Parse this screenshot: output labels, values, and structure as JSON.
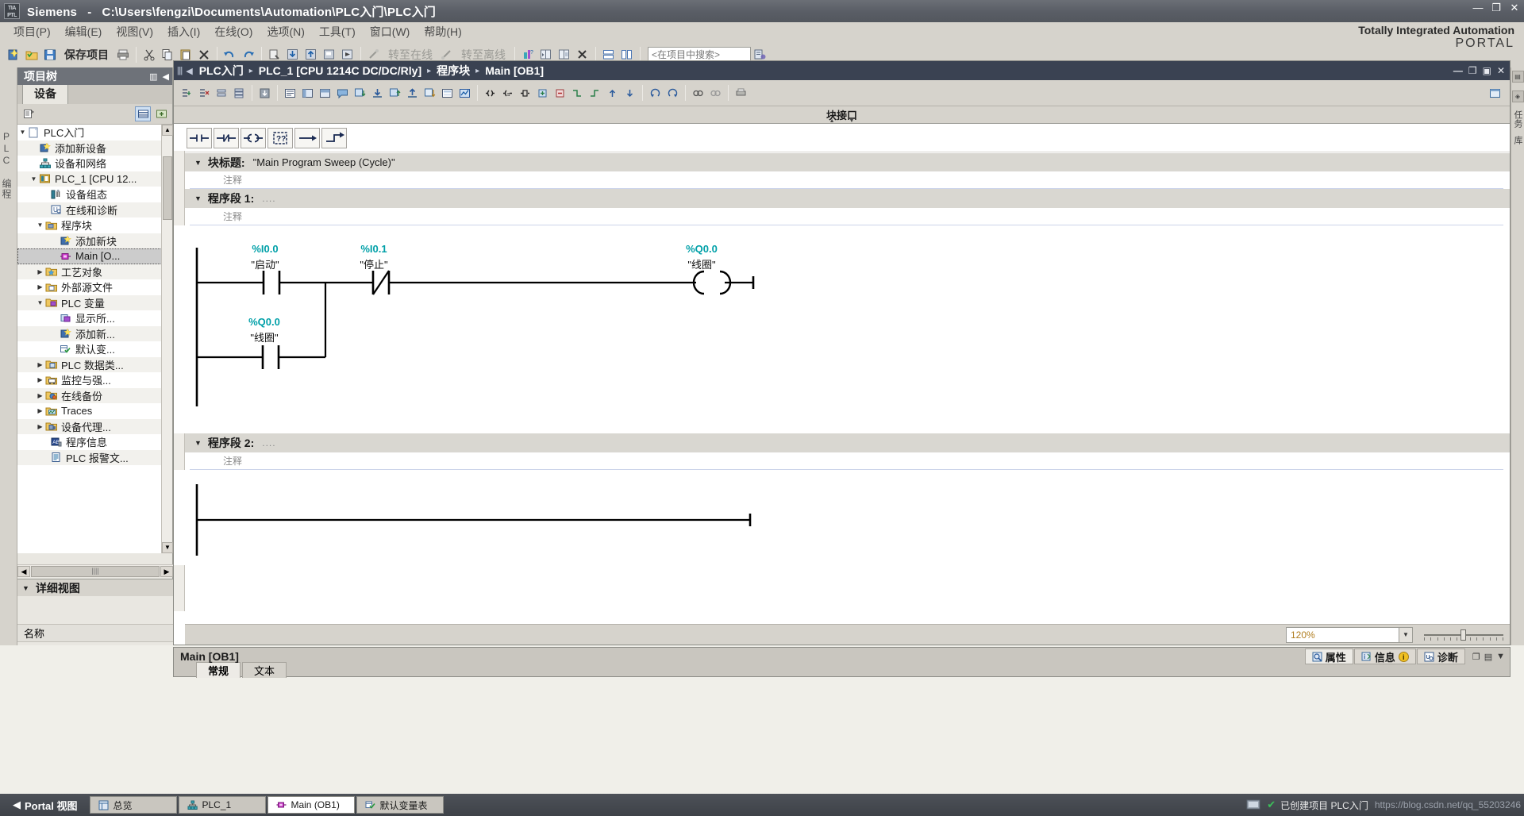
{
  "window": {
    "app_name": "Siemens",
    "separator": "-",
    "path": "C:\\Users\\fengzi\\Documents\\Automation\\PLC入门\\PLC入门",
    "logo_text": "TIA",
    "minimize": "—",
    "maximize": "❐",
    "close": "✕"
  },
  "menubar": [
    {
      "label": "项目(P)"
    },
    {
      "label": "编辑(E)"
    },
    {
      "label": "视图(V)"
    },
    {
      "label": "插入(I)"
    },
    {
      "label": "在线(O)"
    },
    {
      "label": "选项(N)"
    },
    {
      "label": "工具(T)"
    },
    {
      "label": "窗口(W)"
    },
    {
      "label": "帮助(H)"
    }
  ],
  "toolbar": {
    "save_label": "保存项目",
    "goto_online_label": "转至在线",
    "goto_offline_label": "转至离线",
    "search_placeholder": "<在项目中搜索>"
  },
  "brand": {
    "line1": "Totally Integrated Automation",
    "line2": "PORTAL"
  },
  "left_strip": {
    "vertical_label": "PLC 编程"
  },
  "project_tree": {
    "header": "项目树",
    "tab": "设备",
    "nodes": [
      {
        "label": "PLC入门",
        "indent": 0,
        "arrow": "▼",
        "icon": "project-icon"
      },
      {
        "label": "添加新设备",
        "indent": 1,
        "arrow": "",
        "icon": "add-device-icon"
      },
      {
        "label": "设备和网络",
        "indent": 1,
        "arrow": "",
        "icon": "network-icon"
      },
      {
        "label": "PLC_1 [CPU 12...",
        "indent": 1,
        "arrow": "▼",
        "icon": "plc-icon"
      },
      {
        "label": "设备组态",
        "indent": 2,
        "arrow": "",
        "icon": "device-config-icon"
      },
      {
        "label": "在线和诊断",
        "indent": 2,
        "arrow": "",
        "icon": "online-diag-icon"
      },
      {
        "label": "程序块",
        "indent": 2,
        "arrow": "▼",
        "icon": "program-blocks-icon"
      },
      {
        "label": "添加新块",
        "indent": 3,
        "arrow": "",
        "icon": "add-block-icon"
      },
      {
        "label": "Main [O...",
        "indent": 3,
        "arrow": "",
        "icon": "ob-block-icon",
        "selected": true
      },
      {
        "label": "工艺对象",
        "indent": 2,
        "arrow": "▶",
        "icon": "tech-object-icon"
      },
      {
        "label": "外部源文件",
        "indent": 2,
        "arrow": "▶",
        "icon": "external-source-icon"
      },
      {
        "label": "PLC 变量",
        "indent": 2,
        "arrow": "▼",
        "icon": "plc-tags-icon"
      },
      {
        "label": "显示所...",
        "indent": 3,
        "arrow": "",
        "icon": "show-all-tags-icon"
      },
      {
        "label": "添加新...",
        "indent": 3,
        "arrow": "",
        "icon": "add-tag-table-icon"
      },
      {
        "label": "默认变...",
        "indent": 3,
        "arrow": "",
        "icon": "default-tag-table-icon"
      },
      {
        "label": "PLC 数据类...",
        "indent": 2,
        "arrow": "▶",
        "icon": "plc-datatype-icon"
      },
      {
        "label": "监控与强...",
        "indent": 2,
        "arrow": "▶",
        "icon": "watch-force-icon"
      },
      {
        "label": "在线备份",
        "indent": 2,
        "arrow": "▶",
        "icon": "online-backup-icon"
      },
      {
        "label": "Traces",
        "indent": 2,
        "arrow": "▶",
        "icon": "traces-icon"
      },
      {
        "label": "设备代理...",
        "indent": 2,
        "arrow": "▶",
        "icon": "device-proxy-icon"
      },
      {
        "label": "程序信息",
        "indent": 2,
        "arrow": "",
        "icon": "program-info-icon"
      },
      {
        "label": "PLC 报警文...",
        "indent": 2,
        "arrow": "",
        "icon": "plc-alarm-text-icon"
      }
    ],
    "detail_view": {
      "title": "详细视图",
      "column": "名称"
    }
  },
  "editor": {
    "breadcrumb": [
      "PLC入门",
      "PLC_1 [CPU 1214C DC/DC/Rly]",
      "程序块",
      "Main [OB1]"
    ],
    "separator": "▸",
    "block_interface_label": "块接口",
    "block_title_label": "块标题:",
    "block_title_value": "\"Main Program Sweep (Cycle)\"",
    "comment_placeholder": "注释",
    "zoom_value": "120%",
    "instructions": [
      {
        "name": "no-contact-button",
        "glyph": "no-contact"
      },
      {
        "name": "nc-contact-button",
        "glyph": "nc-contact"
      },
      {
        "name": "coil-button",
        "glyph": "coil"
      },
      {
        "name": "empty-box-button",
        "glyph": "box"
      },
      {
        "name": "open-branch-button",
        "glyph": "arrow-right"
      },
      {
        "name": "close-branch-button",
        "glyph": "arrow-branch"
      }
    ],
    "networks": [
      {
        "title": "程序段 1:",
        "dots": "....",
        "comment": "注释",
        "rungs": [
          {
            "elements": [
              {
                "type": "contact-no",
                "address": "%I0.0",
                "tag": "\"启动\""
              },
              {
                "type": "contact-nc",
                "address": "%I0.1",
                "tag": "\"停止\""
              },
              {
                "type": "coil",
                "address": "%Q0.0",
                "tag": "\"线圈\""
              }
            ]
          },
          {
            "branch": true,
            "elements": [
              {
                "type": "contact-no",
                "address": "%Q0.0",
                "tag": "\"线圈\""
              }
            ]
          }
        ]
      },
      {
        "title": "程序段 2:",
        "dots": "....",
        "comment": "注释",
        "rungs": []
      }
    ]
  },
  "bottom_dock": {
    "title": "Main [OB1]",
    "tabs": [
      {
        "label": "属性",
        "icon": "properties-icon",
        "active": true
      },
      {
        "label": "信息",
        "icon": "info-icon",
        "badge": "i",
        "active": false
      },
      {
        "label": "诊断",
        "icon": "diagnostics-icon",
        "active": false
      }
    ],
    "subtabs": [
      {
        "label": "常规",
        "active": true
      },
      {
        "label": "文本",
        "active": false
      }
    ]
  },
  "right_strip": {
    "labels": [
      "任务",
      "库"
    ]
  },
  "taskbar": {
    "portal_view": "Portal 视图",
    "back_arrow": "◀",
    "tasks": [
      {
        "label": "总览",
        "icon": "overview-icon",
        "active": false
      },
      {
        "label": "PLC_1",
        "icon": "plc-icon",
        "active": false
      },
      {
        "label": "Main (OB1)",
        "icon": "ob-block-icon",
        "active": true
      },
      {
        "label": "默认变量表",
        "icon": "tag-table-icon",
        "active": false
      }
    ],
    "status_text": "已创建项目 PLC入门",
    "watermark": "https://blog.csdn.net/qq_55203246"
  },
  "colors": {
    "address_teal": "#00a0a8",
    "titlebar": "#5a5e66",
    "breadcrumb_bg": "#3a4252",
    "panel_bg": "#d6d3cc",
    "zoom_orange": "#b07d1f"
  }
}
